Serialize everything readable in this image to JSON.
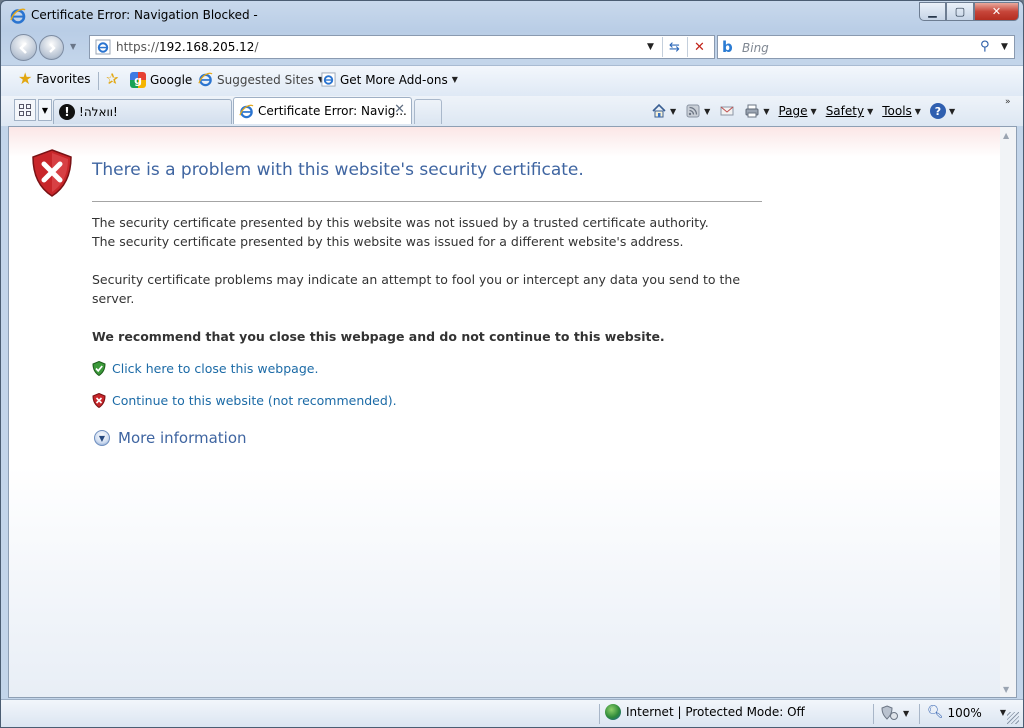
{
  "window": {
    "title": "Certificate Error: Navigation Blocked -",
    "buttons": {
      "minimize": "▁",
      "maximize": "▢",
      "close": "✕"
    }
  },
  "addressbar": {
    "url_prefix": "https://",
    "url_host": "192.168.205.12",
    "url_suffix": "/",
    "search_placeholder": "Bing"
  },
  "favorites": {
    "label": "Favorites",
    "items": [
      {
        "label": "Google",
        "icon": "google-icon"
      },
      {
        "label": "Suggested Sites",
        "icon": "ie-icon"
      },
      {
        "label": "Get More Add-ons",
        "icon": "ie-addons-icon"
      }
    ]
  },
  "tabs": [
    {
      "label": "!וואלה!",
      "icon": "warning-icon",
      "active": false
    },
    {
      "label": "Certificate Error: Navig...",
      "icon": "ie-icon",
      "active": true
    }
  ],
  "commandbar": {
    "page": "Page",
    "safety": "Safety",
    "tools": "Tools"
  },
  "page": {
    "heading": "There is a problem with this website's security certificate.",
    "p1_line1": "The security certificate presented by this website was not issued by a trusted certificate authority.",
    "p1_line2": "The security certificate presented by this website was issued for a different website's address.",
    "p2": "Security certificate problems may indicate an attempt to fool you or intercept any data you send to the server.",
    "recommend": "We recommend that you close this webpage and do not continue to this website.",
    "close_link": "Click here to close this webpage.",
    "continue_link": "Continue to this website (not recommended).",
    "more_info": "More information"
  },
  "statusbar": {
    "zone": "Internet | Protected Mode: Off",
    "zoom": "100%"
  },
  "colors": {
    "heading": "#3f65a1",
    "link": "#1b6aa6",
    "error_red": "#c8262a",
    "safe_green": "#3c9a3a"
  }
}
